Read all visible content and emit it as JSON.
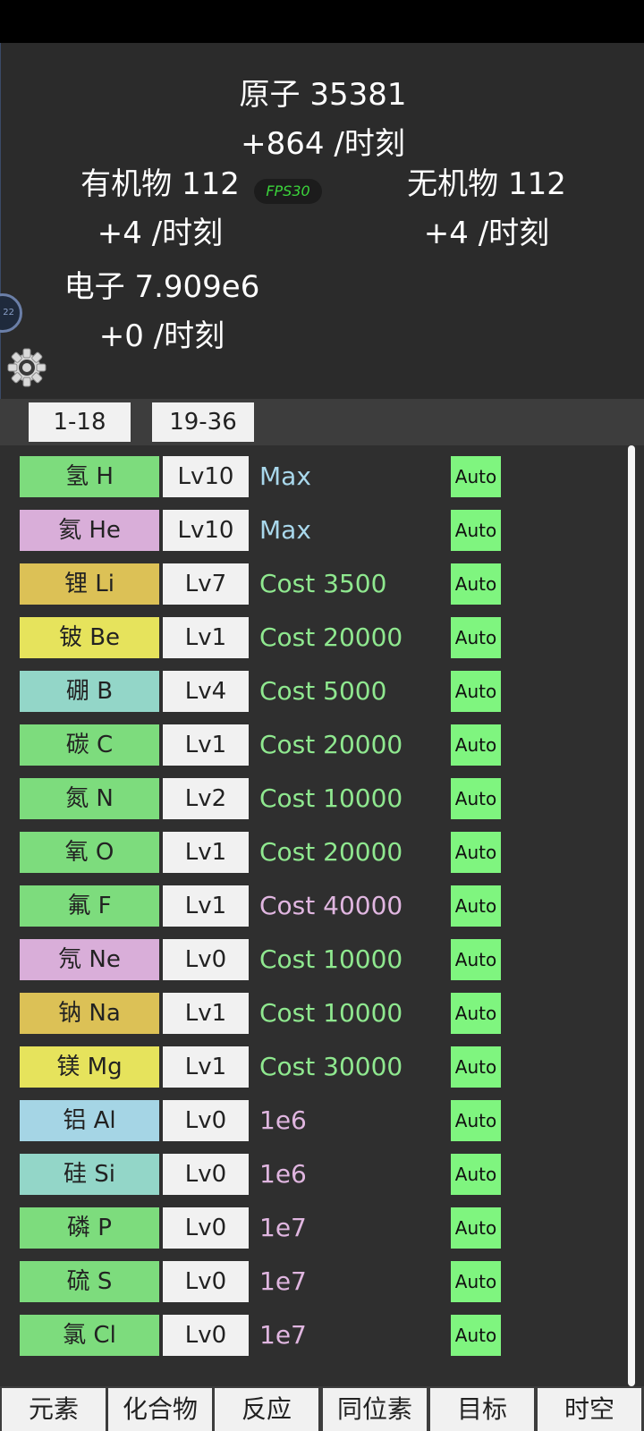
{
  "resources": {
    "atoms": {
      "label": "原子 35381",
      "rate": "+864 /时刻"
    },
    "organic": {
      "label": "有机物 112",
      "rate": "+4 /时刻"
    },
    "inorganic": {
      "label": "无机物 112",
      "rate": "+4 /时刻"
    },
    "electrons": {
      "label": "电子 7.909e6",
      "rate": "+0 /时刻"
    }
  },
  "fps_label": "FPS30",
  "side_badge_text": "22",
  "range_tabs": [
    "1-18",
    "19-36"
  ],
  "elements": [
    {
      "name": "氢 H",
      "level": "Lv10",
      "cost": "Max",
      "auto": "Auto",
      "color": "#7ddc7d",
      "cost_color": "#a9d8ec"
    },
    {
      "name": "氦 He",
      "level": "Lv10",
      "cost": "Max",
      "auto": "Auto",
      "color": "#d9aed9",
      "cost_color": "#a9d8ec"
    },
    {
      "name": "锂 Li",
      "level": "Lv7",
      "cost": "Cost 3500",
      "auto": "Auto",
      "color": "#dcc156",
      "cost_color": "#8fe88f"
    },
    {
      "name": "铍 Be",
      "level": "Lv1",
      "cost": "Cost 20000",
      "auto": "Auto",
      "color": "#e6e35c",
      "cost_color": "#8fe88f"
    },
    {
      "name": "硼 B",
      "level": "Lv4",
      "cost": "Cost 5000",
      "auto": "Auto",
      "color": "#93d6c8",
      "cost_color": "#8fe88f"
    },
    {
      "name": "碳 C",
      "level": "Lv1",
      "cost": "Cost 20000",
      "auto": "Auto",
      "color": "#7ddc7d",
      "cost_color": "#8fe88f"
    },
    {
      "name": "氮 N",
      "level": "Lv2",
      "cost": "Cost 10000",
      "auto": "Auto",
      "color": "#7ddc7d",
      "cost_color": "#8fe88f"
    },
    {
      "name": "氧 O",
      "level": "Lv1",
      "cost": "Cost 20000",
      "auto": "Auto",
      "color": "#7ddc7d",
      "cost_color": "#8fe88f"
    },
    {
      "name": "氟 F",
      "level": "Lv1",
      "cost": "Cost 40000",
      "auto": "Auto",
      "color": "#7ddc7d",
      "cost_color": "#e0b6e0"
    },
    {
      "name": "氖 Ne",
      "level": "Lv0",
      "cost": "Cost 10000",
      "auto": "Auto",
      "color": "#d9aed9",
      "cost_color": "#8fe88f"
    },
    {
      "name": "钠 Na",
      "level": "Lv1",
      "cost": "Cost 10000",
      "auto": "Auto",
      "color": "#dcc156",
      "cost_color": "#8fe88f"
    },
    {
      "name": "镁 Mg",
      "level": "Lv1",
      "cost": "Cost 30000",
      "auto": "Auto",
      "color": "#e6e35c",
      "cost_color": "#8fe88f"
    },
    {
      "name": "铝 Al",
      "level": "Lv0",
      "cost": "1e6",
      "auto": "Auto",
      "color": "#a5d5e5",
      "cost_color": "#e0b6e0"
    },
    {
      "name": "硅 Si",
      "level": "Lv0",
      "cost": "1e6",
      "auto": "Auto",
      "color": "#93d6c8",
      "cost_color": "#e0b6e0"
    },
    {
      "name": "磷 P",
      "level": "Lv0",
      "cost": "1e7",
      "auto": "Auto",
      "color": "#7ddc7d",
      "cost_color": "#e0b6e0"
    },
    {
      "name": "硫 S",
      "level": "Lv0",
      "cost": "1e7",
      "auto": "Auto",
      "color": "#7ddc7d",
      "cost_color": "#e0b6e0"
    },
    {
      "name": "氯 Cl",
      "level": "Lv0",
      "cost": "1e7",
      "auto": "Auto",
      "color": "#7ddc7d",
      "cost_color": "#e0b6e0"
    }
  ],
  "bottom_tabs": [
    "元素",
    "化合物",
    "反应",
    "同位素",
    "目标",
    "时空"
  ]
}
